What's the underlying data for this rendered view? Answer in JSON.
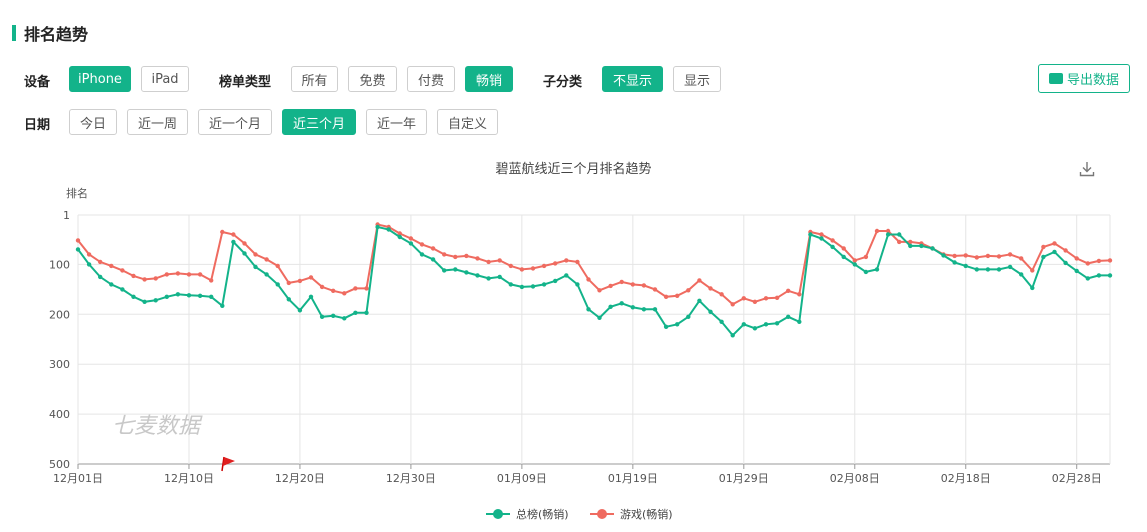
{
  "page": {
    "title": "排名趋势"
  },
  "filters": {
    "device": {
      "label": "设备",
      "options": [
        "iPhone",
        "iPad"
      ],
      "active": 0
    },
    "list_type": {
      "label": "榜单类型",
      "options": [
        "所有",
        "免费",
        "付费",
        "畅销"
      ],
      "active": 3
    },
    "subcategory": {
      "label": "子分类",
      "options": [
        "不显示",
        "显示"
      ],
      "active": 0
    },
    "date": {
      "label": "日期",
      "options": [
        "今日",
        "近一周",
        "近一个月",
        "近三个月",
        "近一年",
        "自定义"
      ],
      "active": 3
    }
  },
  "export_label": "导出数据",
  "icons": {
    "export": "cloud-upload-icon",
    "download": "download-icon",
    "marker": "red-flag-icon"
  },
  "watermark": "七麦数据",
  "colors": {
    "accent": "#13b38a",
    "series_total": "#13b38a",
    "series_game": "#ef6b60"
  },
  "chart_data": {
    "type": "line",
    "title": "碧蓝航线近三个月排名趋势",
    "ylabel": "排名",
    "xlabel": "",
    "ylim": [
      1,
      500
    ],
    "y_inverted": true,
    "y_ticks": [
      "1",
      "100",
      "200",
      "300",
      "400",
      "500"
    ],
    "x_ticks": [
      "12月01日",
      "12月10日",
      "12月20日",
      "12月30日",
      "01月09日",
      "01月19日",
      "01月29日",
      "02月08日",
      "02月18日",
      "02月28日"
    ],
    "x_range": [
      "12月01日",
      "03月04日"
    ],
    "grid": true,
    "legend": "bottom",
    "series": [
      {
        "name": "总榜(畅销)",
        "values": [
          70,
          100,
          125,
          140,
          150,
          165,
          175,
          172,
          165,
          160,
          162,
          163,
          165,
          183,
          55,
          78,
          105,
          120,
          140,
          170,
          192,
          165,
          205,
          203,
          208,
          197,
          197,
          25,
          30,
          45,
          58,
          80,
          90,
          112,
          110,
          116,
          122,
          128,
          125,
          140,
          145,
          144,
          140,
          133,
          122,
          140,
          190,
          207,
          185,
          178,
          186,
          190,
          190,
          225,
          220,
          205,
          173,
          195,
          215,
          242,
          220,
          228,
          220,
          218,
          205,
          215,
          40,
          48,
          65,
          85,
          100,
          115,
          110,
          40,
          40,
          63,
          63,
          68,
          82,
          96,
          103,
          110,
          110,
          110,
          105,
          120,
          147,
          85,
          75,
          97,
          113,
          128,
          122,
          122
        ]
      },
      {
        "name": "游戏(畅销)",
        "values": [
          52,
          80,
          95,
          103,
          112,
          123,
          130,
          128,
          120,
          118,
          120,
          120,
          132,
          35,
          40,
          58,
          80,
          90,
          103,
          137,
          133,
          126,
          145,
          153,
          158,
          148,
          148,
          20,
          25,
          38,
          48,
          60,
          68,
          80,
          85,
          83,
          88,
          95,
          92,
          103,
          110,
          108,
          103,
          98,
          92,
          95,
          130,
          152,
          143,
          135,
          140,
          142,
          150,
          165,
          163,
          152,
          132,
          148,
          160,
          180,
          168,
          175,
          168,
          167,
          153,
          160,
          35,
          40,
          52,
          68,
          92,
          85,
          33,
          33,
          55,
          55,
          58,
          68,
          80,
          83,
          82,
          86,
          83,
          84,
          80,
          88,
          112,
          65,
          58,
          72,
          88,
          98,
          93,
          92
        ]
      }
    ]
  }
}
